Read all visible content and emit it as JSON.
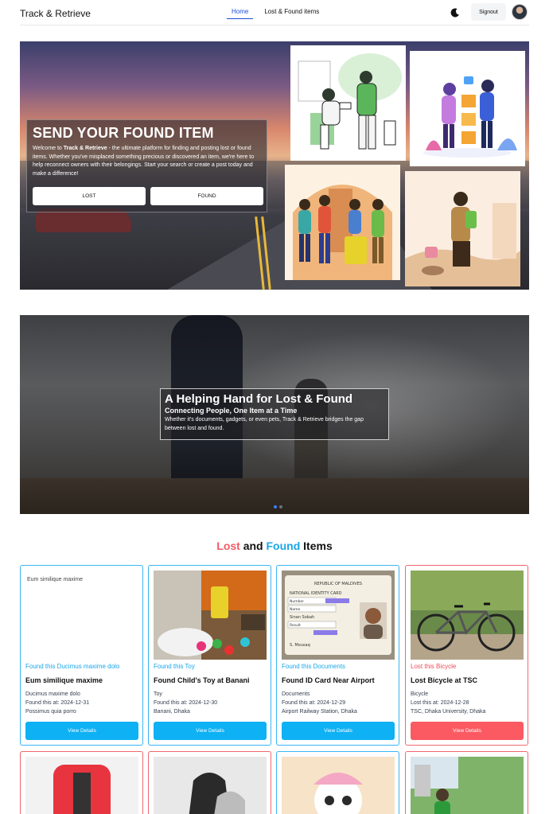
{
  "nav": {
    "brand": "Track & Retrieve",
    "links": [
      "Home",
      "Lost & Found items"
    ],
    "signout_label": "Signout"
  },
  "hero1": {
    "title": "SEND YOUR FOUND ITEM",
    "text_prefix": "Welcome to ",
    "text_brand": "Track & Retrieve",
    "text_suffix": " - the ultimate platform for finding and posting lost or found items. Whether you've misplaced something precious or discovered an item, we're here to help reconnect owners with their belongings. Start your search or create a post today and make a difference!",
    "lost_button": "LOST",
    "found_button": "FOUND"
  },
  "hero2": {
    "title": "A Helping Hand for Lost & Found",
    "subtitle": "Connecting People, One Item at a Time",
    "text": "Whether it's documents, gadgets, or even pets, Track & Retrieve bridges the gap between lost and found."
  },
  "section": {
    "lost_word": "Lost",
    "and_word": "and",
    "found_word": "Found",
    "items_word": "Items"
  },
  "cards": [
    {
      "alt": "Eum similique maxime",
      "status": "Found this Ducimus maxime dolo",
      "title": "Eum similique maxime",
      "category": "Ducimus maxime dolo",
      "date": "Found this at: 2024-12-31",
      "location": "Possimus quia porro",
      "button": "View Details"
    },
    {
      "status": "Found this Toy",
      "title": "Found Child's Toy at Banani",
      "category": "Toy",
      "date": "Found this at: 2024-12-30",
      "location": "Banani, Dhaka",
      "button": "View Details"
    },
    {
      "status": "Found this Documents",
      "title": "Found ID Card Near Airport",
      "category": "Documents",
      "date": "Found this at: 2024-12-29",
      "location": "Airport Railway Station, Dhaka",
      "button": "View Details",
      "id_card": {
        "country": "REPUBLIC OF MALDIVES",
        "label": "NATIONAL IDENTITY CARD",
        "field1": "Number",
        "field2": "Name",
        "name": "Sinan Sobah",
        "field3": "Result",
        "signature": "S. Mousaq"
      }
    },
    {
      "status": "Lost this Bicycle",
      "title": "Lost Bicycle at TSC",
      "category": "Bicycle",
      "date": "Lost this at: 2024-12-28",
      "location": "TSC, Dhaka University, Dhaka",
      "button": "View Details"
    }
  ],
  "icons": {
    "theme": "moon-icon",
    "avatar": "user-avatar"
  },
  "colors": {
    "found_accent": "#1aa6e8",
    "lost_accent": "#f25b64",
    "found_button": "#0eb1f4",
    "lost_button": "#fb5a62"
  }
}
